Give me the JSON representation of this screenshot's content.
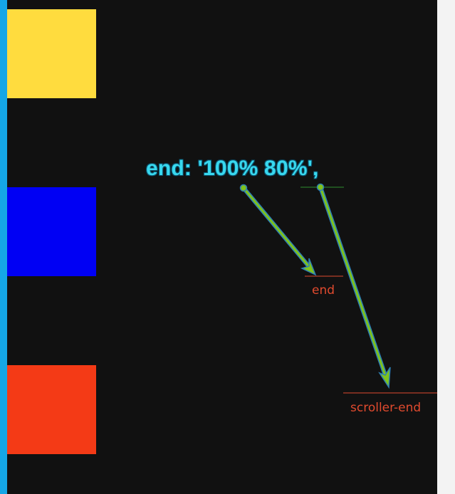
{
  "annotation": {
    "code_text": "end: '100% 80%',"
  },
  "markers": {
    "end_label": "end",
    "scroller_end_label": "scroller-end"
  },
  "colors": {
    "background": "#111111",
    "gutter": "#f3f3f3",
    "left_edge": "#15a6e6",
    "box_yellow": "#ffdc3e",
    "box_blue": "#0000f4",
    "box_red": "#f43a16",
    "code_text": "#38d8ee",
    "marker_red": "#e04a2e",
    "marker_green": "#2f8f2f",
    "arrow_fill": "#7fc31c",
    "arrow_outline": "#2d7fb3"
  },
  "icons": {
    "arrow_to_end": "arrow-icon",
    "arrow_to_scroller_end": "arrow-icon"
  }
}
